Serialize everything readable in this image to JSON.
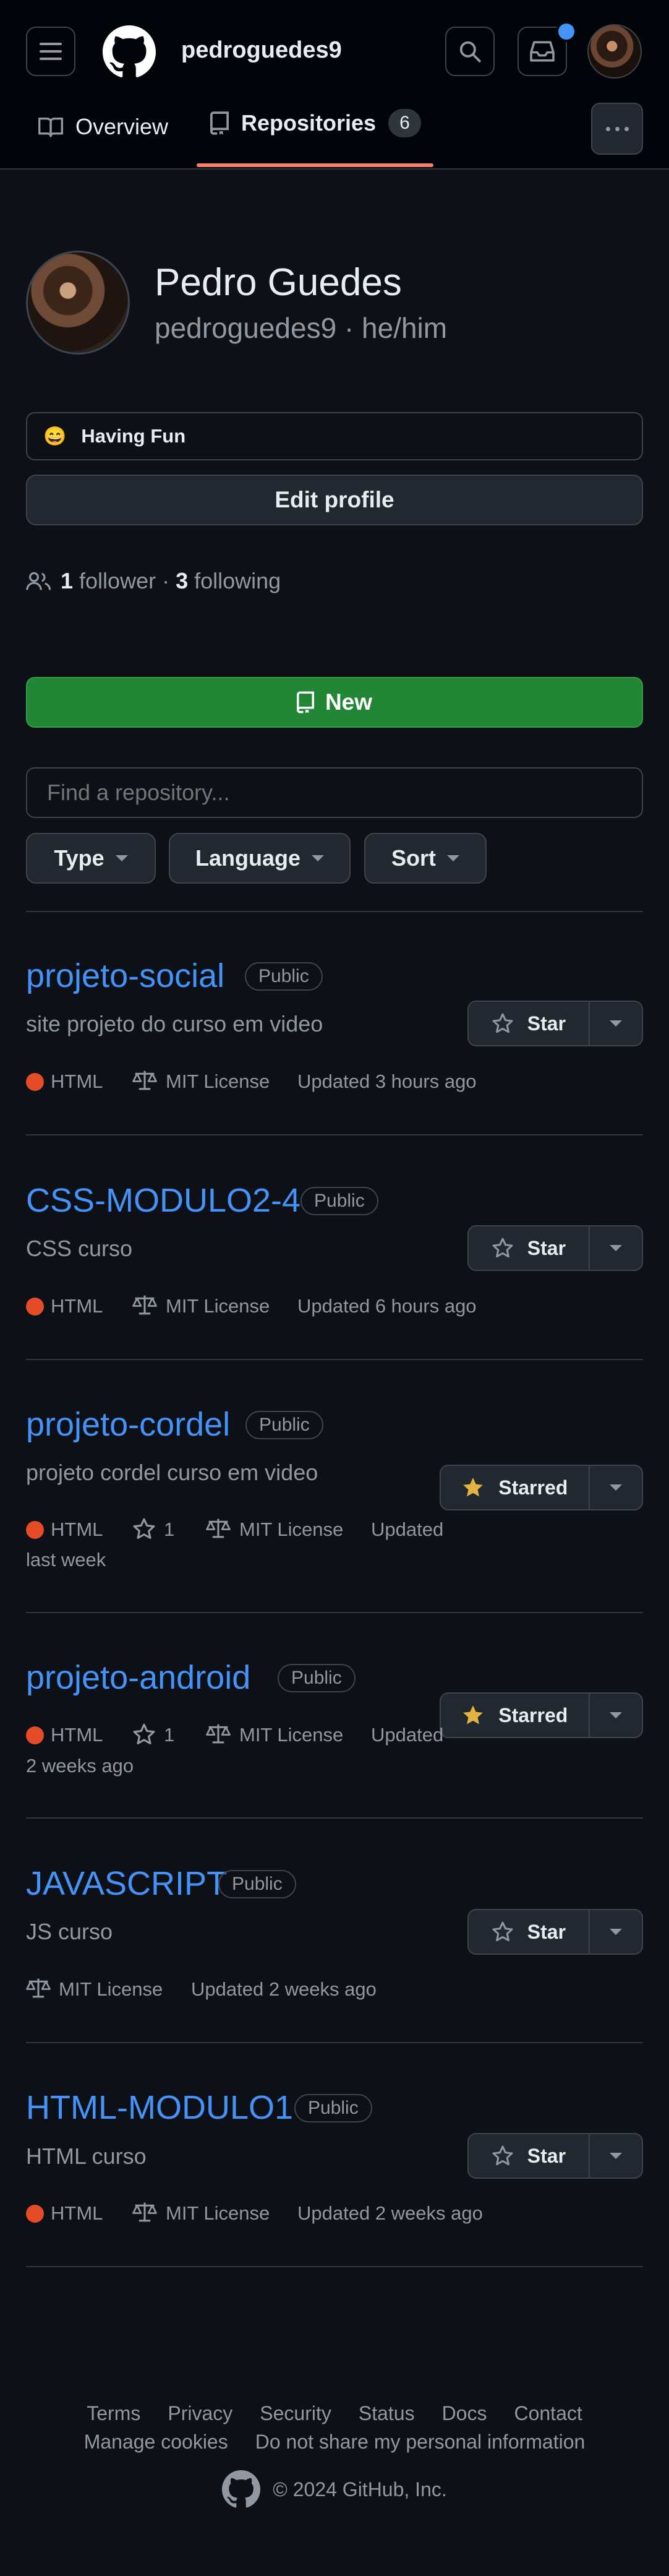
{
  "header": {
    "username": "pedroguedes9",
    "tabs": [
      {
        "label": "Overview"
      },
      {
        "label": "Repositories",
        "count": "6"
      }
    ]
  },
  "profile": {
    "name": "Pedro Guedes",
    "login_pronouns": "pedroguedes9 · he/him",
    "status_emoji": "😄",
    "status_text": "Having Fun",
    "edit_label": "Edit profile",
    "followers_count": "1",
    "followers_label": "follower",
    "sep": "·",
    "following_count": "3",
    "following_label": "following"
  },
  "toolbar": {
    "new_label": "New",
    "search_placeholder": "Find a repository...",
    "type_label": "Type",
    "language_label": "Language",
    "sort_label": "Sort"
  },
  "repos": [
    {
      "name": "projeto-social",
      "visibility": "Public",
      "description": "site projeto do curso em video",
      "language": "HTML",
      "license": "MIT License",
      "updated": "Updated 3 hours ago",
      "star_label": "Star"
    },
    {
      "name": "CSS-MODULO2-4",
      "visibility": "Public",
      "description": "CSS curso",
      "language": "HTML",
      "license": "MIT License",
      "updated": "Updated 6 hours ago",
      "star_label": "Star"
    },
    {
      "name": "projeto-cordel",
      "visibility": "Public",
      "description": "projeto cordel curso em video",
      "language": "HTML",
      "stars": "1",
      "license": "MIT License",
      "updated_1": "Updated",
      "updated_2": "last week",
      "star_label": "Starred"
    },
    {
      "name": "projeto-android",
      "visibility": "Public",
      "language": "HTML",
      "stars": "1",
      "license": "MIT License",
      "updated_1": "Updated",
      "updated_2": "2 weeks ago",
      "star_label": "Starred"
    },
    {
      "name": "JAVASCRIPT",
      "visibility": "Public",
      "description": "JS curso",
      "license": "MIT License",
      "updated": "Updated 2 weeks ago",
      "star_label": "Star"
    },
    {
      "name": "HTML-MODULO1",
      "visibility": "Public",
      "description": "HTML curso",
      "language": "HTML",
      "license": "MIT License",
      "updated": "Updated 2 weeks ago",
      "star_label": "Star"
    }
  ],
  "footer": {
    "links": [
      "Terms",
      "Privacy",
      "Security",
      "Status",
      "Docs",
      "Contact"
    ],
    "links2": [
      "Manage cookies",
      "Do not share my personal information"
    ],
    "copyright": "© 2024 GitHub, Inc."
  },
  "colors": {
    "accent": "#4493f8",
    "green": "#238636",
    "html_lang": "#e34c26",
    "star": "#e3b341",
    "tab_underline": "#f78166",
    "notif": "#4493f8"
  }
}
